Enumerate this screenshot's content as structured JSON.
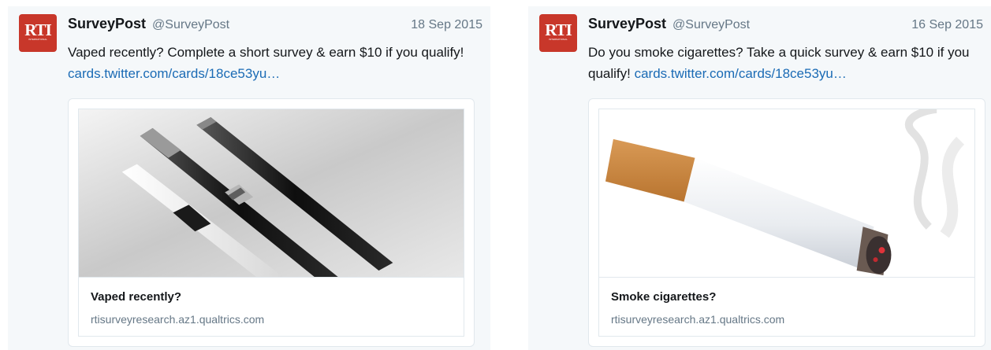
{
  "tweets": [
    {
      "avatar_text": "RTI",
      "avatar_subtext": "INTERNATIONAL",
      "name": "SurveyPost",
      "handle": "@SurveyPost",
      "date": "18 Sep 2015",
      "text": "Vaped recently? Complete a short survey & earn $10 if you qualify! ",
      "link": "cards.twitter.com/cards/18ce53yu…",
      "card": {
        "image": "e-cigarette-photo",
        "title": "Vaped recently?",
        "domain": "rtisurveyresearch.az1.qualtrics.com"
      }
    },
    {
      "avatar_text": "RTI",
      "avatar_subtext": "INTERNATIONAL",
      "name": "SurveyPost",
      "handle": "@SurveyPost",
      "date": "16 Sep 2015",
      "text": "Do you smoke cigarettes? Take a quick survey & earn $10 if you qualify! ",
      "link": "cards.twitter.com/cards/18ce53yu…",
      "card": {
        "image": "cigarette-photo",
        "title": "Smoke cigarettes?",
        "domain": "rtisurveyresearch.az1.qualtrics.com"
      }
    }
  ],
  "colors": {
    "link": "#1b6bb5",
    "avatar": "#c8372a",
    "muted": "#657786",
    "background": "#f5f8fa"
  }
}
